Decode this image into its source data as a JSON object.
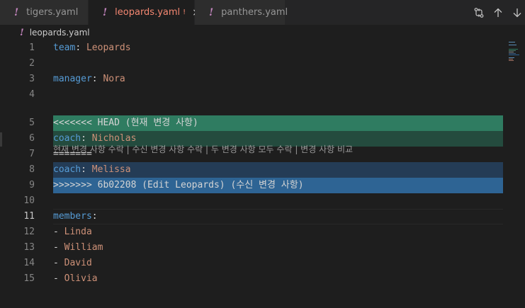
{
  "tabs": [
    {
      "name": "tigers.yaml",
      "icon": "yaml-exclamation-icon"
    },
    {
      "name": "leopards.yaml",
      "icon": "yaml-exclamation-icon",
      "modified_mark": "!",
      "close": "×"
    },
    {
      "name": "panthers.yaml",
      "icon": "yaml-exclamation-icon"
    }
  ],
  "breadcrumb": {
    "file": "leopards.yaml"
  },
  "codelens": {
    "accept_current": "현재 변경 사항 수락",
    "accept_incoming": "수신 변경 사항 수락",
    "accept_both": "두 변경 사항 모두 수락",
    "compare": "변경 사항 비교",
    "separator": " | "
  },
  "lines": [
    {
      "num": "1",
      "key": "team",
      "sep": ": ",
      "value": "Leopards"
    },
    {
      "num": "2"
    },
    {
      "num": "3",
      "key": "manager",
      "sep": ": ",
      "value": "Nora"
    },
    {
      "num": "4"
    },
    {
      "num": "5",
      "text": "<<<<<<< HEAD (현재 변경 사항)"
    },
    {
      "num": "6",
      "key": "coach",
      "sep": ": ",
      "value": "Nicholas"
    },
    {
      "num": "7",
      "text": "======="
    },
    {
      "num": "8",
      "key": "coach",
      "sep": ": ",
      "value": "Melissa"
    },
    {
      "num": "9",
      "text": ">>>>>>> 6b02208 (Edit Leopards) (수신 변경 사항)"
    },
    {
      "num": "10"
    },
    {
      "num": "11",
      "key": "members",
      "sep": ":"
    },
    {
      "num": "12",
      "dash": "- ",
      "value": "Linda"
    },
    {
      "num": "13",
      "dash": "- ",
      "value": "William"
    },
    {
      "num": "14",
      "dash": "- ",
      "value": "David"
    },
    {
      "num": "15",
      "dash": "- ",
      "value": "Olivia"
    }
  ],
  "colors": {
    "current_header": "#2f7c61",
    "current_body": "#244b3e",
    "incoming_body": "#243c56",
    "incoming_header": "#2e6494",
    "key": "#569cd6",
    "value": "#ce9178",
    "tab_modified": "#f48771"
  }
}
